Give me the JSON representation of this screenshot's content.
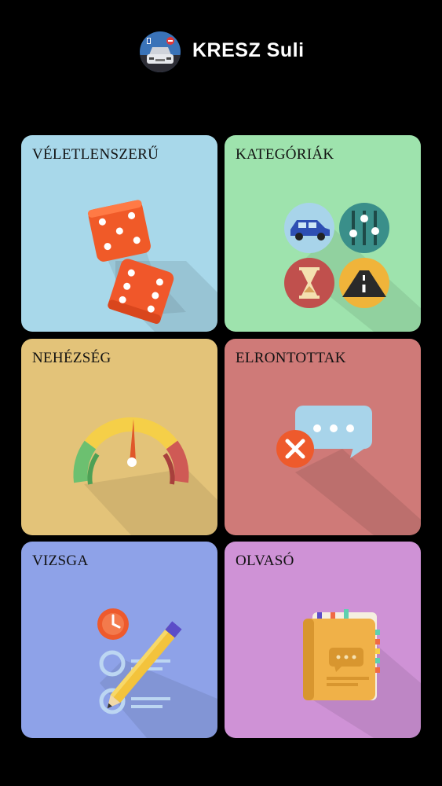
{
  "app": {
    "title": "KRESZ Suli",
    "logo_icon": "car-stop-sign-logo-icon"
  },
  "tiles": [
    {
      "label": "VÉLETLENSZERŰ",
      "icon": "dice-icon",
      "color": "#a8d8ea"
    },
    {
      "label": "KATEGÓRIÁK",
      "icon": "categories-icon",
      "color": "#9ee3ad"
    },
    {
      "label": "NEHÉZSÉG",
      "icon": "speedometer-icon",
      "color": "#e3c379"
    },
    {
      "label": "ELRONTOTTAK",
      "icon": "wrong-answer-chat-icon",
      "color": "#cf7a78"
    },
    {
      "label": "VIZSGA",
      "icon": "exam-pencil-icon",
      "color": "#8ea2e8"
    },
    {
      "label": "OLVASÓ",
      "icon": "book-icon",
      "color": "#cf92d6"
    }
  ]
}
